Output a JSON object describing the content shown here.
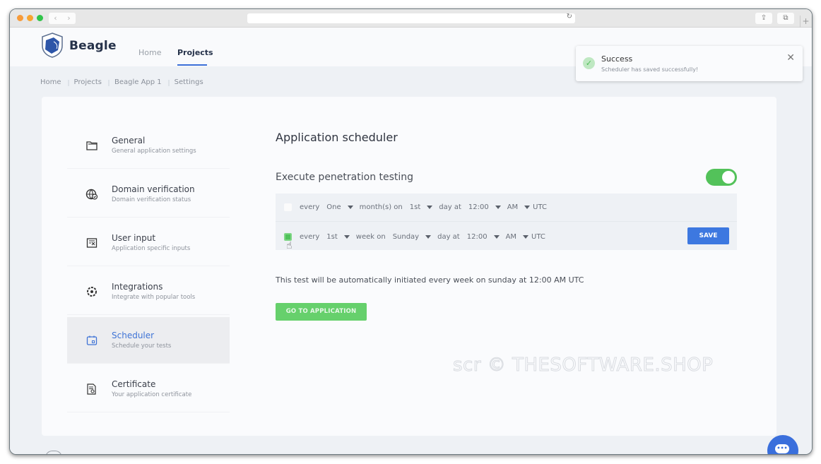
{
  "browser": {
    "back_glyph": "‹",
    "forward_glyph": "›",
    "reload_glyph": "↻",
    "share_glyph": "⇪",
    "tabs_glyph": "⧉",
    "plus_glyph": "+"
  },
  "header": {
    "brand": "Beagle",
    "nav": [
      {
        "label": "Home",
        "active": false
      },
      {
        "label": "Projects",
        "active": true
      }
    ]
  },
  "breadcrumb": [
    "Home",
    "Projects",
    "Beagle App 1",
    "Settings"
  ],
  "sidebar": {
    "items": [
      {
        "title": "General",
        "subtitle": "General application settings",
        "icon": "folder-icon",
        "active": false
      },
      {
        "title": "Domain verification",
        "subtitle": "Domain verification status",
        "icon": "globe-check-icon",
        "active": false
      },
      {
        "title": "User input",
        "subtitle": "Application specific inputs",
        "icon": "form-input-icon",
        "active": false
      },
      {
        "title": "Integrations",
        "subtitle": "Integrate with popular tools",
        "icon": "puzzle-gear-icon",
        "active": false
      },
      {
        "title": "Scheduler",
        "subtitle": "Schedule your tests",
        "icon": "calendar-icon",
        "active": true
      },
      {
        "title": "Certificate",
        "subtitle": "Your application certificate",
        "icon": "certificate-icon",
        "active": false
      }
    ]
  },
  "main": {
    "title": "Application scheduler",
    "exec_label": "Execute penetration testing",
    "exec_enabled": true,
    "schedule_rows": [
      {
        "checked": false,
        "every": "every",
        "frequency": "One",
        "unit_label": "month(s) on",
        "day": "1st",
        "day_label": "day at",
        "time": "12:00",
        "meridiem": "AM",
        "tz": "UTC"
      },
      {
        "checked": true,
        "every": "every",
        "frequency": "1st",
        "unit_label": "week on",
        "day": "Sunday",
        "day_label": "day at",
        "time": "12:00",
        "meridiem": "AM",
        "tz": "UTC"
      }
    ],
    "save_label": "SAVE",
    "summary": "This test will be automatically initiated every week on sunday at 12:00 AM UTC",
    "go_label": "GO TO APPLICATION"
  },
  "toast": {
    "title": "Success",
    "message": "Scheduler has saved successfully!",
    "icon_glyph": "✓",
    "close_glyph": "✕"
  },
  "watermark": "scr © THESOFTWARE.SHOP",
  "chat": {
    "glyph": "•••"
  },
  "colors": {
    "accent": "#3d78e0",
    "success": "#53c25a",
    "active_nav": "#3f74d6"
  }
}
